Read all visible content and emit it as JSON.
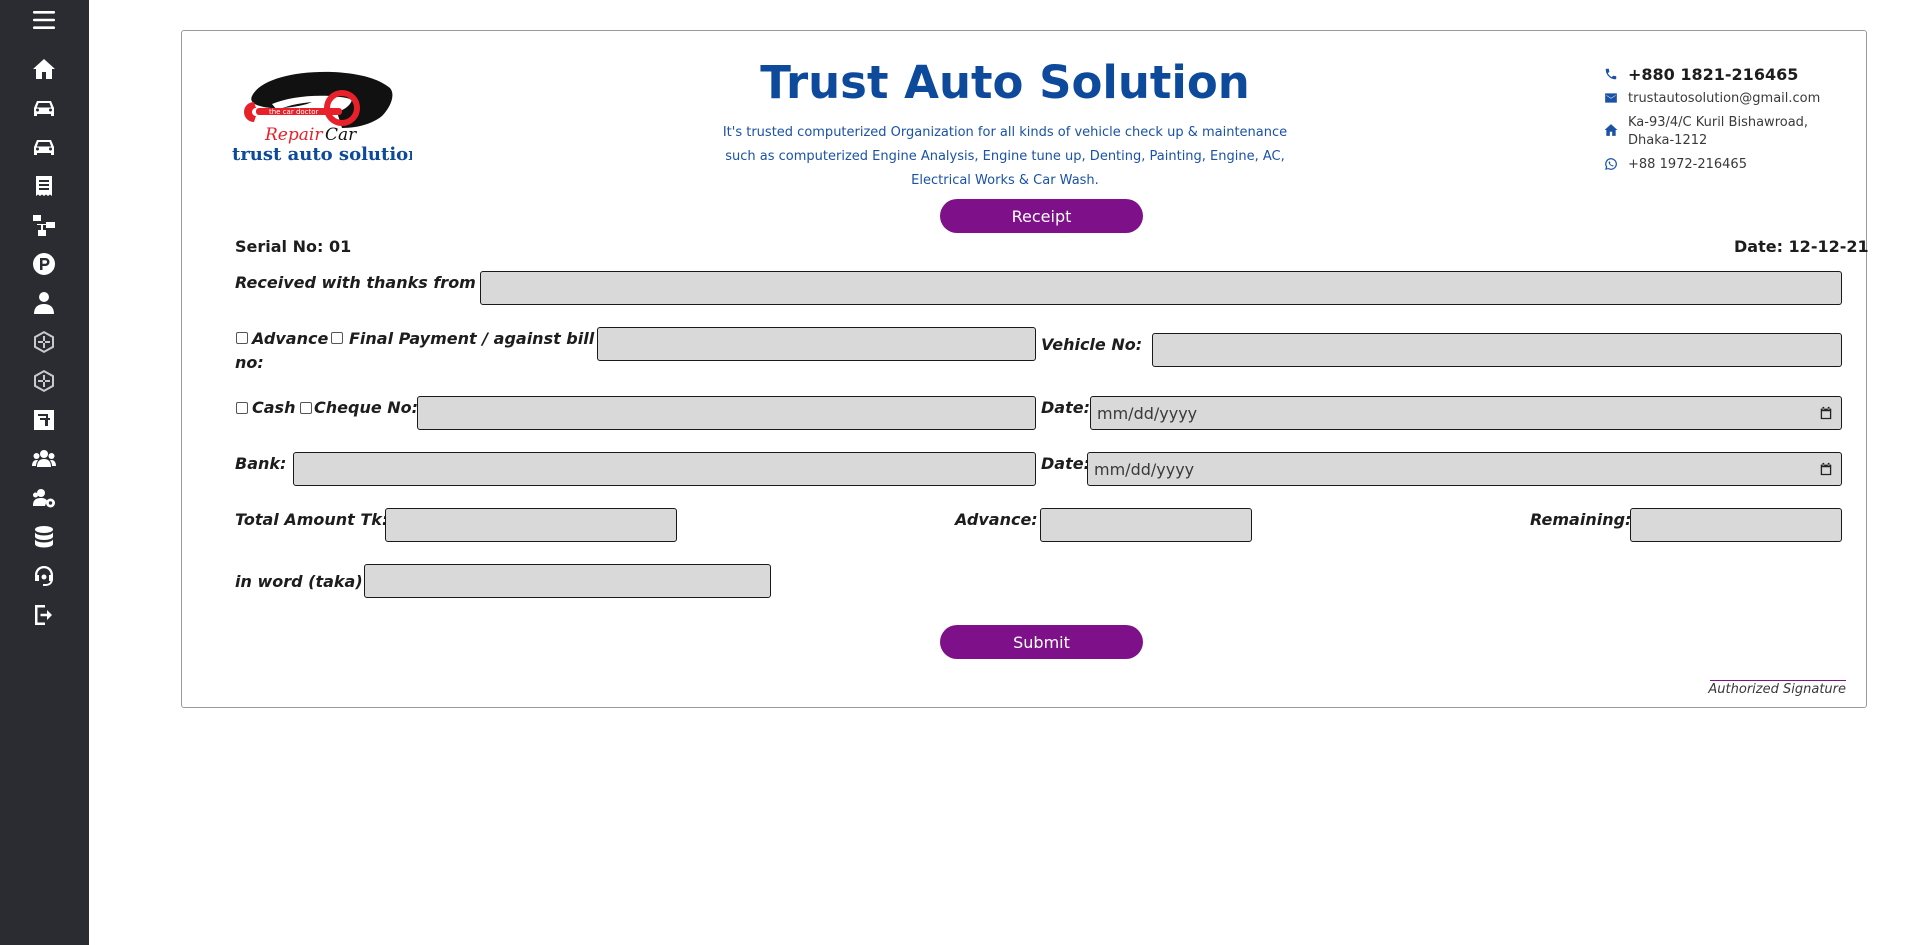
{
  "sidebar": {
    "icons": [
      "menu-icon",
      "home-icon",
      "car-icon",
      "car-icon-2",
      "receipt-icon",
      "workflow-icon",
      "parking-icon",
      "employee-icon",
      "network-icon",
      "network-icon-2",
      "money-icon",
      "team-icon",
      "settings-team-icon",
      "database-icon",
      "support-icon",
      "logout-icon"
    ]
  },
  "header": {
    "logo_small_text": "the car doctor",
    "logo_repair": "Repair",
    "logo_car": "Car",
    "logo_brand": "trust auto solution",
    "title": "Trust Auto Solution",
    "tagline_1": "It's trusted computerized Organization for all kinds of vehicle check up & maintenance",
    "tagline_2": "such as computerized Engine Analysis, Engine tune up, Denting, Painting, Engine, AC,",
    "tagline_3": "Electrical Works & Car Wash."
  },
  "contact": {
    "phone": "+880 1821-216465",
    "email": "trustautosolution@gmail.com",
    "address_1": "Ka-93/4/C Kuril Bishawroad,",
    "address_2": "Dhaka-1212",
    "whatsapp": "+88 1972-216465"
  },
  "receipt": {
    "button_label": "Receipt",
    "serial": "Serial No: 01",
    "date": "Date: 12-12-21",
    "received_label": "Received with thanks from",
    "advance_label": "Advance",
    "final_payment_label_1": "Final Payment / against bill",
    "final_payment_label_2": "no:",
    "vehicle_label": "Vehicle No:",
    "cash_label": "Cash",
    "cheque_label": "Cheque No:",
    "date_label": "Date:",
    "date_placeholder": "mm/dd/yyyy",
    "bank_label": "Bank:",
    "total_label": "Total Amount Tk:",
    "advance_amount_label": "Advance:",
    "remaining_label": "Remaining:",
    "in_word_label": "in word (taka)",
    "submit_label": "Submit",
    "signature_label": "Authorized Signature"
  },
  "colors": {
    "sidebar_bg": "#2a2c31",
    "title_blue": "#0d4a9c",
    "button_purple": "#7e1089",
    "input_gray": "#d9d9d9"
  }
}
